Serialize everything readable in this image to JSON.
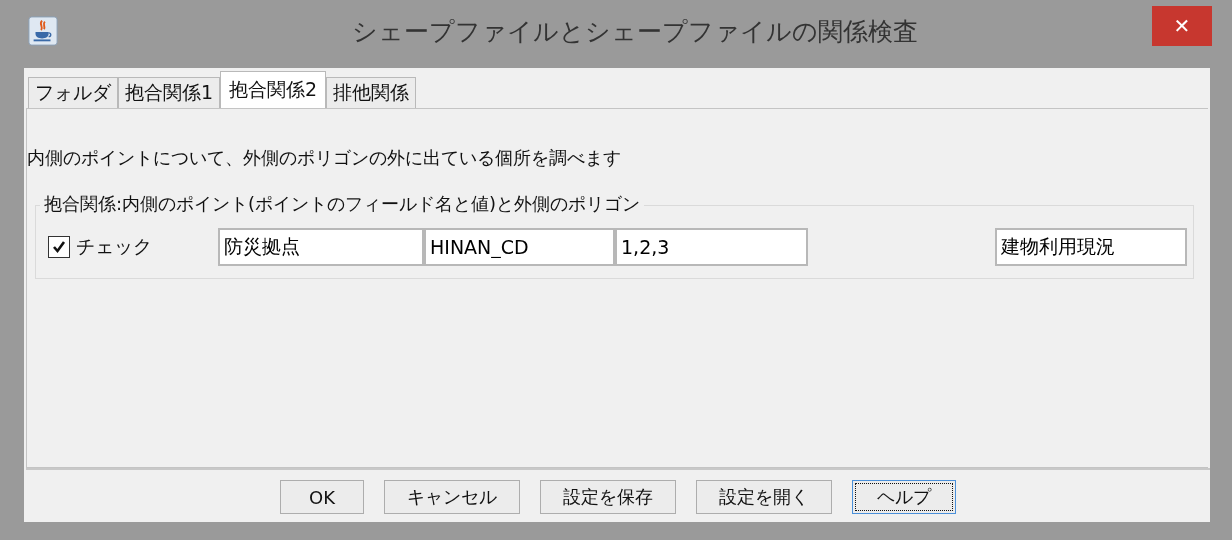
{
  "window": {
    "title": "シェープファイルとシェープファイルの関係検査",
    "close": "✕"
  },
  "tabs": [
    {
      "label": "フォルダ",
      "selected": false
    },
    {
      "label": "抱合関係1",
      "selected": false
    },
    {
      "label": "抱合関係2",
      "selected": true
    },
    {
      "label": "排他関係",
      "selected": false
    }
  ],
  "description": "内側のポイントについて、外側のポリゴンの外に出ている個所を調べます",
  "group": {
    "title": "抱合関係:内側のポイント(ポイントのフィールド名と値)と外側のポリゴン",
    "check": {
      "label": "チェック",
      "checked": true
    },
    "fields": [
      {
        "value": "防災拠点"
      },
      {
        "value": "HINAN_CD"
      },
      {
        "value": "1,2,3"
      },
      {
        "value": "建物利用現況"
      }
    ]
  },
  "buttons": [
    {
      "label": "OK",
      "focused": false
    },
    {
      "label": "キャンセル",
      "focused": false
    },
    {
      "label": "設定を保存",
      "focused": false
    },
    {
      "label": "設定を開く",
      "focused": false
    },
    {
      "label": "ヘルプ",
      "focused": true
    }
  ]
}
